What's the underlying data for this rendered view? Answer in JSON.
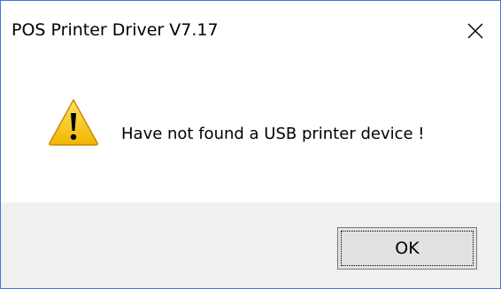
{
  "window": {
    "title": "POS Printer Driver V7.17",
    "close_icon": "close-icon"
  },
  "message": {
    "icon": "warning-icon",
    "text": "Have not found a USB printer device !"
  },
  "buttons": {
    "ok_label": "OK"
  },
  "colors": {
    "border_accent": "#3a7bd5",
    "footer_bg": "#f0f0f0",
    "button_bg": "#e1e1e1",
    "warning_yellow": "#f5c400"
  }
}
